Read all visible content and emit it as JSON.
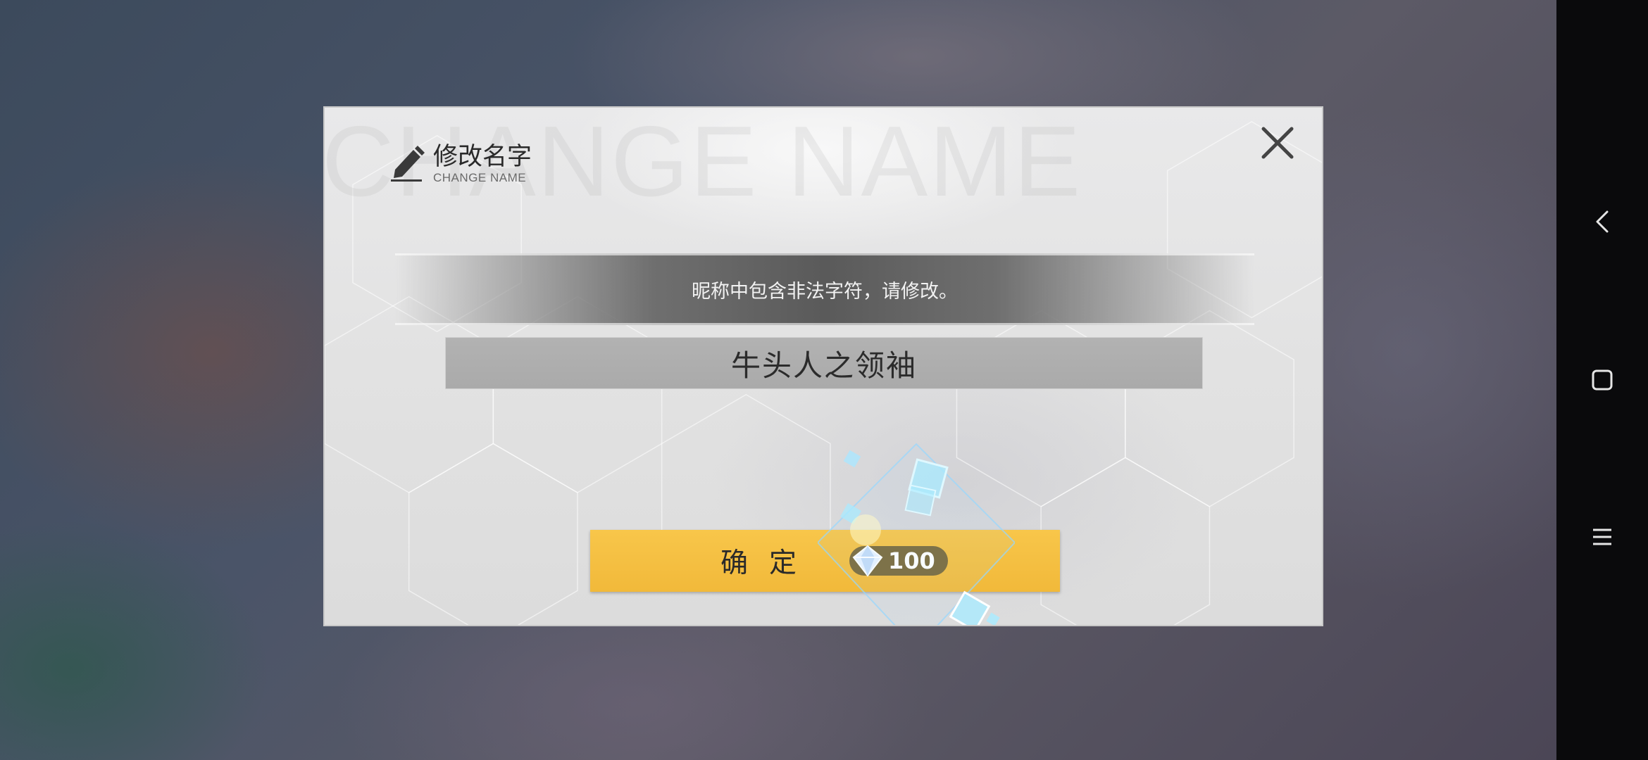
{
  "dialog": {
    "watermark": "CHANGE NAME",
    "title_zh": "修改名字",
    "title_en": "CHANGE NAME",
    "error_message": "昵称中包含非法字符，请修改。",
    "name_value": "牛头人之领袖",
    "confirm_label": "确定",
    "cost": "100",
    "cost_icon": "diamond-crystal-icon",
    "accent_color": "#f5c142"
  },
  "navbar": {
    "back_icon": "back-chevron-icon",
    "home_icon": "square-home-icon",
    "menu_icon": "menu-lines-icon"
  }
}
